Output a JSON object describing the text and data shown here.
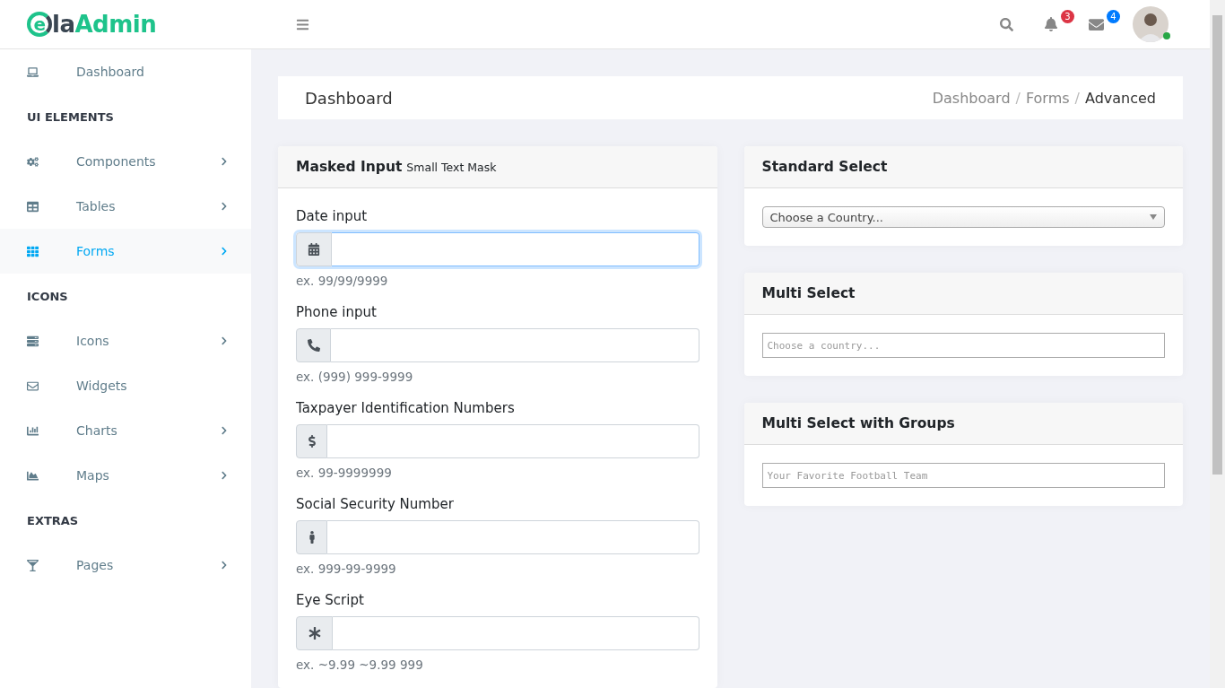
{
  "header": {
    "logo": {
      "mark": "e",
      "dark": "la",
      "accent": "Admin"
    },
    "notifications": {
      "count": "3"
    },
    "messages": {
      "count": "4"
    }
  },
  "sidebar": {
    "items": [
      {
        "kind": "link",
        "label": "Dashboard",
        "has_submenu": false,
        "selected": false
      },
      {
        "kind": "heading",
        "label": "UI ELEMENTS"
      },
      {
        "kind": "link",
        "label": "Components",
        "has_submenu": true,
        "selected": false
      },
      {
        "kind": "link",
        "label": "Tables",
        "has_submenu": true,
        "selected": false
      },
      {
        "kind": "link",
        "label": "Forms",
        "has_submenu": true,
        "selected": true
      },
      {
        "kind": "heading",
        "label": "ICONS"
      },
      {
        "kind": "link",
        "label": "Icons",
        "has_submenu": true,
        "selected": false
      },
      {
        "kind": "link",
        "label": "Widgets",
        "has_submenu": false,
        "selected": false
      },
      {
        "kind": "link",
        "label": "Charts",
        "has_submenu": true,
        "selected": false
      },
      {
        "kind": "link",
        "label": "Maps",
        "has_submenu": true,
        "selected": false
      },
      {
        "kind": "heading",
        "label": "EXTRAS"
      },
      {
        "kind": "link",
        "label": "Pages",
        "has_submenu": true,
        "selected": false
      }
    ]
  },
  "page_title": "Dashboard",
  "breadcrumb": [
    {
      "label": "Dashboard",
      "selected": false
    },
    {
      "separator": "/",
      "label": "Forms",
      "selected": false
    },
    {
      "separator": "/",
      "label": "Advanced",
      "selected": true
    }
  ],
  "masked_input": {
    "title": "Masked Input",
    "subtitle": "Small Text Mask",
    "fields": [
      {
        "label": "Date input",
        "hint": "ex. 99/99/9999",
        "focused": true
      },
      {
        "label": "Phone input",
        "hint": "ex. (999) 999-9999",
        "focused": false
      },
      {
        "label": "Taxpayer Identification Numbers",
        "hint": "ex. 99-9999999",
        "focused": false
      },
      {
        "label": "Social Security Number",
        "hint": "ex. 999-99-9999",
        "focused": false
      },
      {
        "label": "Eye Script",
        "hint": "ex. ~9.99 ~9.99 999",
        "focused": false
      }
    ]
  },
  "select_cards": [
    {
      "kind": "select",
      "title": "Standard Select",
      "placeholder": "Choose a Country..."
    },
    {
      "kind": "multi",
      "title": "Multi Select",
      "placeholder": "Choose a country..."
    },
    {
      "kind": "multi",
      "title": "Multi Select with Groups",
      "placeholder": "Your Favorite Football Team"
    }
  ]
}
